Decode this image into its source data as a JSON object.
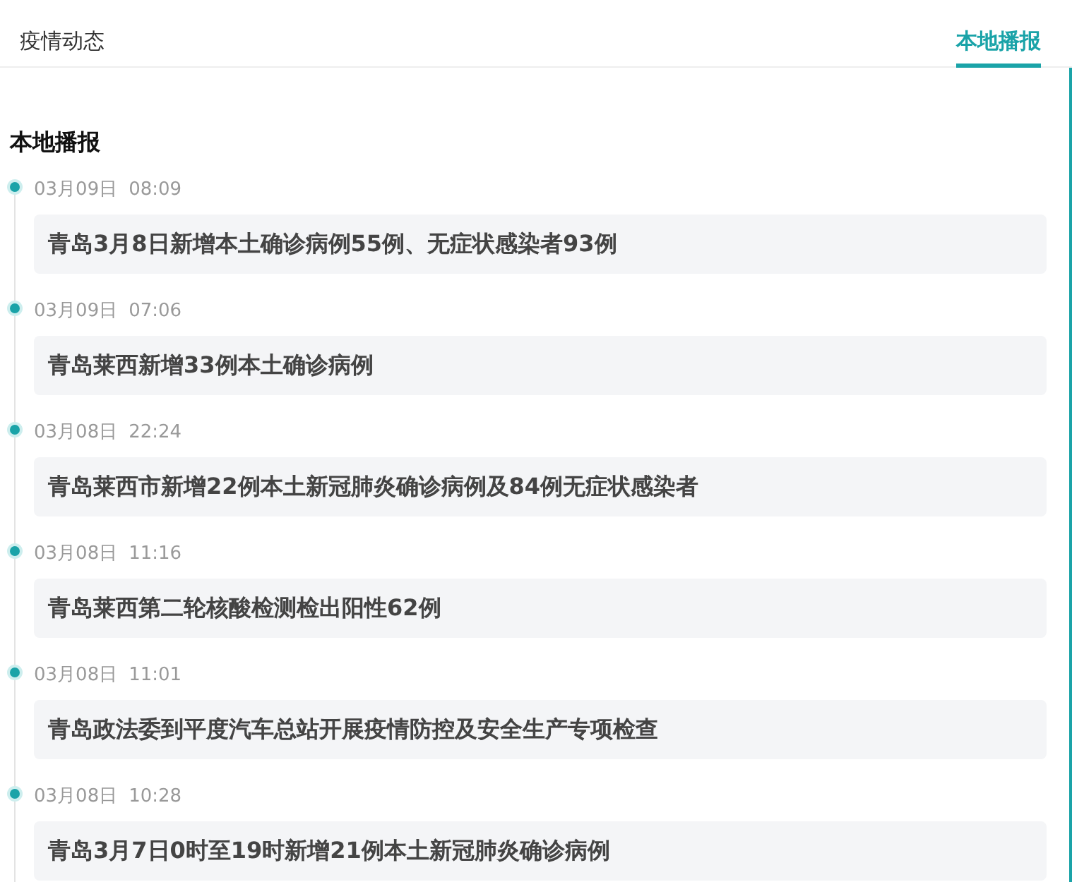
{
  "tabs": [
    {
      "label": "疫情动态",
      "selected": false
    },
    {
      "label": "本地播报",
      "selected": true
    }
  ],
  "section": {
    "title": "本地播报"
  },
  "timeline": [
    {
      "date": "03月09日",
      "time": "08:09",
      "headline": "青岛3月8日新增本土确诊病例55例、无症状感染者93例"
    },
    {
      "date": "03月09日",
      "time": "07:06",
      "headline": "青岛莱西新增33例本土确诊病例"
    },
    {
      "date": "03月08日",
      "time": "22:24",
      "headline": "青岛莱西市新增22例本土新冠肺炎确诊病例及84例无症状感染者"
    },
    {
      "date": "03月08日",
      "time": "11:16",
      "headline": "青岛莱西第二轮核酸检测检出阳性62例"
    },
    {
      "date": "03月08日",
      "time": "11:01",
      "headline": "青岛政法委到平度汽车总站开展疫情防控及安全生产专项检查"
    },
    {
      "date": "03月08日",
      "time": "10:28",
      "headline": "青岛3月7日0时至19时新增21例本土新冠肺炎确诊病例"
    }
  ]
}
